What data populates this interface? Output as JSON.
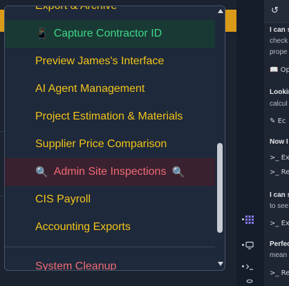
{
  "dropdown": {
    "items": [
      {
        "label": "Export & Archive",
        "emoji": "",
        "emoji_after": ""
      },
      {
        "label": "Capture Contractor ID",
        "emoji": "📱",
        "emoji_after": ""
      },
      {
        "label": "Preview James's Interface",
        "emoji": "",
        "emoji_after": ""
      },
      {
        "label": "AI Agent Management",
        "emoji": "",
        "emoji_after": ""
      },
      {
        "label": "Project Estimation & Materials",
        "emoji": "",
        "emoji_after": ""
      },
      {
        "label": "Supplier Price Comparison",
        "emoji": "",
        "emoji_after": ""
      },
      {
        "label": "Admin Site Inspections",
        "emoji": "🔍",
        "emoji_after": "🔍"
      },
      {
        "label": "CIS Payroll",
        "emoji": "",
        "emoji_after": ""
      },
      {
        "label": "Accounting Exports",
        "emoji": "",
        "emoji_after": ""
      },
      {
        "label": "System Cleanup",
        "emoji": "",
        "emoji_after": ""
      }
    ]
  },
  "activity_bar": {
    "icons": [
      "sparkle-grid-icon",
      "monitor-icon",
      "terminal-icon",
      "database-icon"
    ]
  },
  "chat": {
    "history_icon": "↺",
    "lines": [
      {
        "text": "I can s",
        "style": "bold"
      },
      {
        "text": "check",
        "style": "muted"
      },
      {
        "text": "prope",
        "style": "muted"
      },
      {
        "text": "Op",
        "style": "action",
        "icon": "📖"
      },
      {
        "text": "Lookin",
        "style": "bold"
      },
      {
        "text": "calcul",
        "style": "muted"
      },
      {
        "text": "Ec",
        "style": "action",
        "icon": "✎"
      },
      {
        "text": "Now I",
        "style": "bold"
      },
      {
        "text": "Ex",
        "style": "action",
        "icon": ">_"
      },
      {
        "text": "Re",
        "style": "action",
        "icon": ">_"
      },
      {
        "text": "I can s",
        "style": "bold"
      },
      {
        "text": "to see",
        "style": "muted"
      },
      {
        "text": "Ex",
        "style": "action",
        "icon": ">_"
      },
      {
        "text": "Perfec",
        "style": "bold"
      },
      {
        "text": "mean",
        "style": "muted"
      },
      {
        "text": "Re",
        "style": "action",
        "icon": ">_"
      }
    ]
  }
}
